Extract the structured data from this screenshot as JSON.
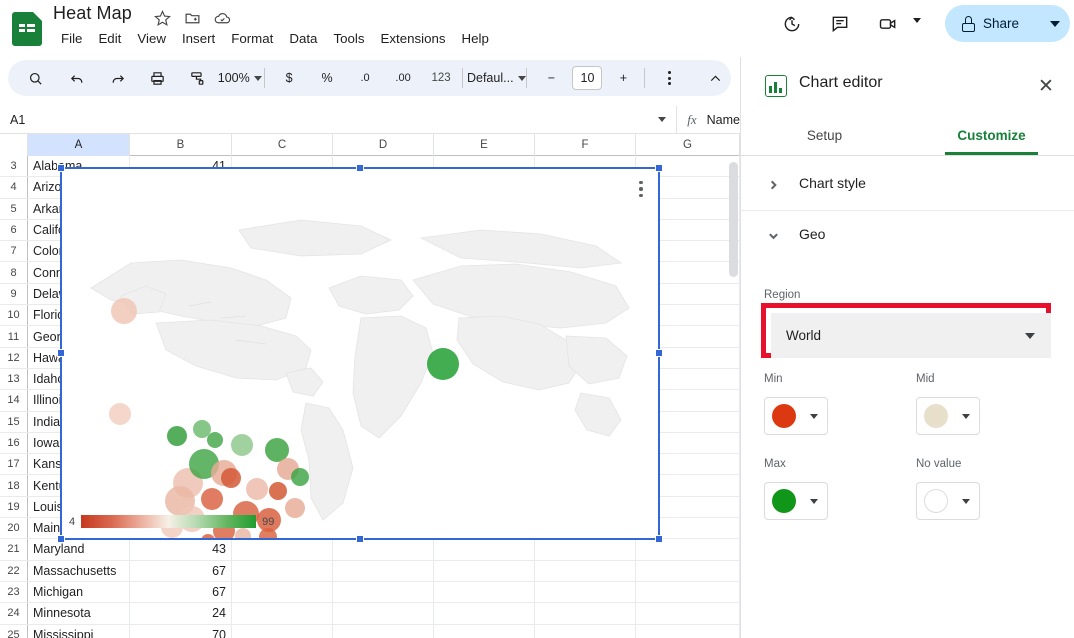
{
  "app": {
    "doc_title": "Heat Map",
    "logo_name": "google-sheets-logo"
  },
  "menubar": [
    "File",
    "Edit",
    "View",
    "Insert",
    "Format",
    "Data",
    "Tools",
    "Extensions",
    "Help"
  ],
  "title_actions": [
    {
      "name": "star-icon",
      "label": "Star"
    },
    {
      "name": "move-to-folder-icon",
      "label": "Move"
    },
    {
      "name": "cloud-saved-icon",
      "label": "Saved to Drive"
    }
  ],
  "top_right": {
    "history_icon": "version-history-icon",
    "comment_icon": "comment-icon",
    "meet_icon": "video-call-icon",
    "share_label": "Share",
    "share_lock_icon": "lock-icon"
  },
  "toolbar": {
    "search_icon": "search-icon",
    "undo_icon": "undo-icon",
    "redo_icon": "redo-icon",
    "print_icon": "print-icon",
    "paint_format_icon": "paint-format-icon",
    "zoom_value": "100%",
    "currency_label": "$",
    "percent_label": "%",
    "decrease_decimal_label": ".0",
    "increase_decimal_label": ".00",
    "format_123_label": "123",
    "font_name": "Defaul...",
    "font_size_minus": "−",
    "font_size_value": "10",
    "font_size_plus": "+",
    "more_icon": "more-vertical-icon",
    "collapse_icon": "chevron-up-icon"
  },
  "formula_bar": {
    "cell_ref": "A1",
    "fx_label": "fx",
    "content": "Name"
  },
  "grid": {
    "columns": [
      "A",
      "B",
      "C",
      "D",
      "E",
      "F",
      "G"
    ],
    "selected_column": "A",
    "rows": [
      {
        "n": "3",
        "a": "Alabama",
        "b": "41"
      },
      {
        "n": "4",
        "a": "Arizona",
        "b": ""
      },
      {
        "n": "5",
        "a": "Arkansas",
        "b": ""
      },
      {
        "n": "6",
        "a": "California",
        "b": ""
      },
      {
        "n": "7",
        "a": "Colorado",
        "b": ""
      },
      {
        "n": "8",
        "a": "Connecticut",
        "b": ""
      },
      {
        "n": "9",
        "a": "Delaware",
        "b": ""
      },
      {
        "n": "10",
        "a": "Florida",
        "b": ""
      },
      {
        "n": "11",
        "a": "Georgia",
        "b": ""
      },
      {
        "n": "12",
        "a": "Hawaii",
        "b": ""
      },
      {
        "n": "13",
        "a": "Idaho",
        "b": ""
      },
      {
        "n": "14",
        "a": "Illinois",
        "b": ""
      },
      {
        "n": "15",
        "a": "Indiana",
        "b": ""
      },
      {
        "n": "16",
        "a": "Iowa",
        "b": ""
      },
      {
        "n": "17",
        "a": "Kansas",
        "b": ""
      },
      {
        "n": "18",
        "a": "Kentucky",
        "b": ""
      },
      {
        "n": "19",
        "a": "Louisiana",
        "b": ""
      },
      {
        "n": "20",
        "a": "Maine",
        "b": ""
      },
      {
        "n": "21",
        "a": "Maryland",
        "b": "43"
      },
      {
        "n": "22",
        "a": "Massachusetts",
        "b": "67"
      },
      {
        "n": "23",
        "a": "Michigan",
        "b": "67"
      },
      {
        "n": "24",
        "a": "Minnesota",
        "b": "24"
      },
      {
        "n": "25",
        "a": "Mississippi",
        "b": "70"
      }
    ]
  },
  "chart": {
    "menu_icon": "chart-more-options-icon",
    "legend_min": "4",
    "legend_max": "99"
  },
  "chart_data": {
    "type": "heatmap",
    "title": "",
    "region": "World",
    "color_min": "#c6391e",
    "color_mid": "#e8dfcb",
    "color_max": "#1f9d2f",
    "color_novalue": "#ffffff",
    "legend_range": [
      4,
      99
    ],
    "categories": [
      "Maryland",
      "Massachusetts",
      "Michigan",
      "Minnesota",
      "Mississippi",
      "Alabama"
    ],
    "values": [
      43,
      67,
      67,
      24,
      70,
      41
    ],
    "xlabel": "Name",
    "ylabel": ""
  },
  "panel": {
    "title": "Chart editor",
    "icon": "chart-editor-icon",
    "close_icon": "close-icon",
    "tabs": [
      {
        "label": "Setup",
        "active": false
      },
      {
        "label": "Customize",
        "active": true
      }
    ],
    "sections": [
      {
        "label": "Chart style",
        "expanded": false
      },
      {
        "label": "Geo",
        "expanded": true
      }
    ],
    "geo": {
      "region_label": "Region",
      "region_value": "World",
      "highlight_color": "#e8112d",
      "colors": [
        {
          "label": "Min",
          "value": "#dc3912"
        },
        {
          "label": "Mid",
          "value": "#e8dfcb"
        },
        {
          "label": "Max",
          "value": "#109618"
        },
        {
          "label": "No value",
          "value": "#ffffff"
        }
      ]
    }
  }
}
